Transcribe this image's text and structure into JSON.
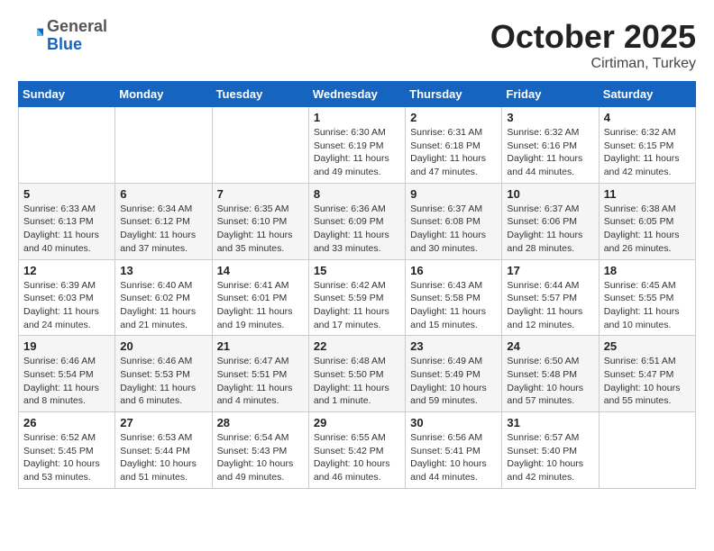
{
  "header": {
    "logo": {
      "general": "General",
      "blue": "Blue"
    },
    "month": "October 2025",
    "location": "Cirtiman, Turkey"
  },
  "weekdays": [
    "Sunday",
    "Monday",
    "Tuesday",
    "Wednesday",
    "Thursday",
    "Friday",
    "Saturday"
  ],
  "weeks": [
    [
      {
        "day": "",
        "sunrise": "",
        "sunset": "",
        "daylight": ""
      },
      {
        "day": "",
        "sunrise": "",
        "sunset": "",
        "daylight": ""
      },
      {
        "day": "",
        "sunrise": "",
        "sunset": "",
        "daylight": ""
      },
      {
        "day": "1",
        "sunrise": "Sunrise: 6:30 AM",
        "sunset": "Sunset: 6:19 PM",
        "daylight": "Daylight: 11 hours and 49 minutes."
      },
      {
        "day": "2",
        "sunrise": "Sunrise: 6:31 AM",
        "sunset": "Sunset: 6:18 PM",
        "daylight": "Daylight: 11 hours and 47 minutes."
      },
      {
        "day": "3",
        "sunrise": "Sunrise: 6:32 AM",
        "sunset": "Sunset: 6:16 PM",
        "daylight": "Daylight: 11 hours and 44 minutes."
      },
      {
        "day": "4",
        "sunrise": "Sunrise: 6:32 AM",
        "sunset": "Sunset: 6:15 PM",
        "daylight": "Daylight: 11 hours and 42 minutes."
      }
    ],
    [
      {
        "day": "5",
        "sunrise": "Sunrise: 6:33 AM",
        "sunset": "Sunset: 6:13 PM",
        "daylight": "Daylight: 11 hours and 40 minutes."
      },
      {
        "day": "6",
        "sunrise": "Sunrise: 6:34 AM",
        "sunset": "Sunset: 6:12 PM",
        "daylight": "Daylight: 11 hours and 37 minutes."
      },
      {
        "day": "7",
        "sunrise": "Sunrise: 6:35 AM",
        "sunset": "Sunset: 6:10 PM",
        "daylight": "Daylight: 11 hours and 35 minutes."
      },
      {
        "day": "8",
        "sunrise": "Sunrise: 6:36 AM",
        "sunset": "Sunset: 6:09 PM",
        "daylight": "Daylight: 11 hours and 33 minutes."
      },
      {
        "day": "9",
        "sunrise": "Sunrise: 6:37 AM",
        "sunset": "Sunset: 6:08 PM",
        "daylight": "Daylight: 11 hours and 30 minutes."
      },
      {
        "day": "10",
        "sunrise": "Sunrise: 6:37 AM",
        "sunset": "Sunset: 6:06 PM",
        "daylight": "Daylight: 11 hours and 28 minutes."
      },
      {
        "day": "11",
        "sunrise": "Sunrise: 6:38 AM",
        "sunset": "Sunset: 6:05 PM",
        "daylight": "Daylight: 11 hours and 26 minutes."
      }
    ],
    [
      {
        "day": "12",
        "sunrise": "Sunrise: 6:39 AM",
        "sunset": "Sunset: 6:03 PM",
        "daylight": "Daylight: 11 hours and 24 minutes."
      },
      {
        "day": "13",
        "sunrise": "Sunrise: 6:40 AM",
        "sunset": "Sunset: 6:02 PM",
        "daylight": "Daylight: 11 hours and 21 minutes."
      },
      {
        "day": "14",
        "sunrise": "Sunrise: 6:41 AM",
        "sunset": "Sunset: 6:01 PM",
        "daylight": "Daylight: 11 hours and 19 minutes."
      },
      {
        "day": "15",
        "sunrise": "Sunrise: 6:42 AM",
        "sunset": "Sunset: 5:59 PM",
        "daylight": "Daylight: 11 hours and 17 minutes."
      },
      {
        "day": "16",
        "sunrise": "Sunrise: 6:43 AM",
        "sunset": "Sunset: 5:58 PM",
        "daylight": "Daylight: 11 hours and 15 minutes."
      },
      {
        "day": "17",
        "sunrise": "Sunrise: 6:44 AM",
        "sunset": "Sunset: 5:57 PM",
        "daylight": "Daylight: 11 hours and 12 minutes."
      },
      {
        "day": "18",
        "sunrise": "Sunrise: 6:45 AM",
        "sunset": "Sunset: 5:55 PM",
        "daylight": "Daylight: 11 hours and 10 minutes."
      }
    ],
    [
      {
        "day": "19",
        "sunrise": "Sunrise: 6:46 AM",
        "sunset": "Sunset: 5:54 PM",
        "daylight": "Daylight: 11 hours and 8 minutes."
      },
      {
        "day": "20",
        "sunrise": "Sunrise: 6:46 AM",
        "sunset": "Sunset: 5:53 PM",
        "daylight": "Daylight: 11 hours and 6 minutes."
      },
      {
        "day": "21",
        "sunrise": "Sunrise: 6:47 AM",
        "sunset": "Sunset: 5:51 PM",
        "daylight": "Daylight: 11 hours and 4 minutes."
      },
      {
        "day": "22",
        "sunrise": "Sunrise: 6:48 AM",
        "sunset": "Sunset: 5:50 PM",
        "daylight": "Daylight: 11 hours and 1 minute."
      },
      {
        "day": "23",
        "sunrise": "Sunrise: 6:49 AM",
        "sunset": "Sunset: 5:49 PM",
        "daylight": "Daylight: 10 hours and 59 minutes."
      },
      {
        "day": "24",
        "sunrise": "Sunrise: 6:50 AM",
        "sunset": "Sunset: 5:48 PM",
        "daylight": "Daylight: 10 hours and 57 minutes."
      },
      {
        "day": "25",
        "sunrise": "Sunrise: 6:51 AM",
        "sunset": "Sunset: 5:47 PM",
        "daylight": "Daylight: 10 hours and 55 minutes."
      }
    ],
    [
      {
        "day": "26",
        "sunrise": "Sunrise: 6:52 AM",
        "sunset": "Sunset: 5:45 PM",
        "daylight": "Daylight: 10 hours and 53 minutes."
      },
      {
        "day": "27",
        "sunrise": "Sunrise: 6:53 AM",
        "sunset": "Sunset: 5:44 PM",
        "daylight": "Daylight: 10 hours and 51 minutes."
      },
      {
        "day": "28",
        "sunrise": "Sunrise: 6:54 AM",
        "sunset": "Sunset: 5:43 PM",
        "daylight": "Daylight: 10 hours and 49 minutes."
      },
      {
        "day": "29",
        "sunrise": "Sunrise: 6:55 AM",
        "sunset": "Sunset: 5:42 PM",
        "daylight": "Daylight: 10 hours and 46 minutes."
      },
      {
        "day": "30",
        "sunrise": "Sunrise: 6:56 AM",
        "sunset": "Sunset: 5:41 PM",
        "daylight": "Daylight: 10 hours and 44 minutes."
      },
      {
        "day": "31",
        "sunrise": "Sunrise: 6:57 AM",
        "sunset": "Sunset: 5:40 PM",
        "daylight": "Daylight: 10 hours and 42 minutes."
      },
      {
        "day": "",
        "sunrise": "",
        "sunset": "",
        "daylight": ""
      }
    ]
  ]
}
